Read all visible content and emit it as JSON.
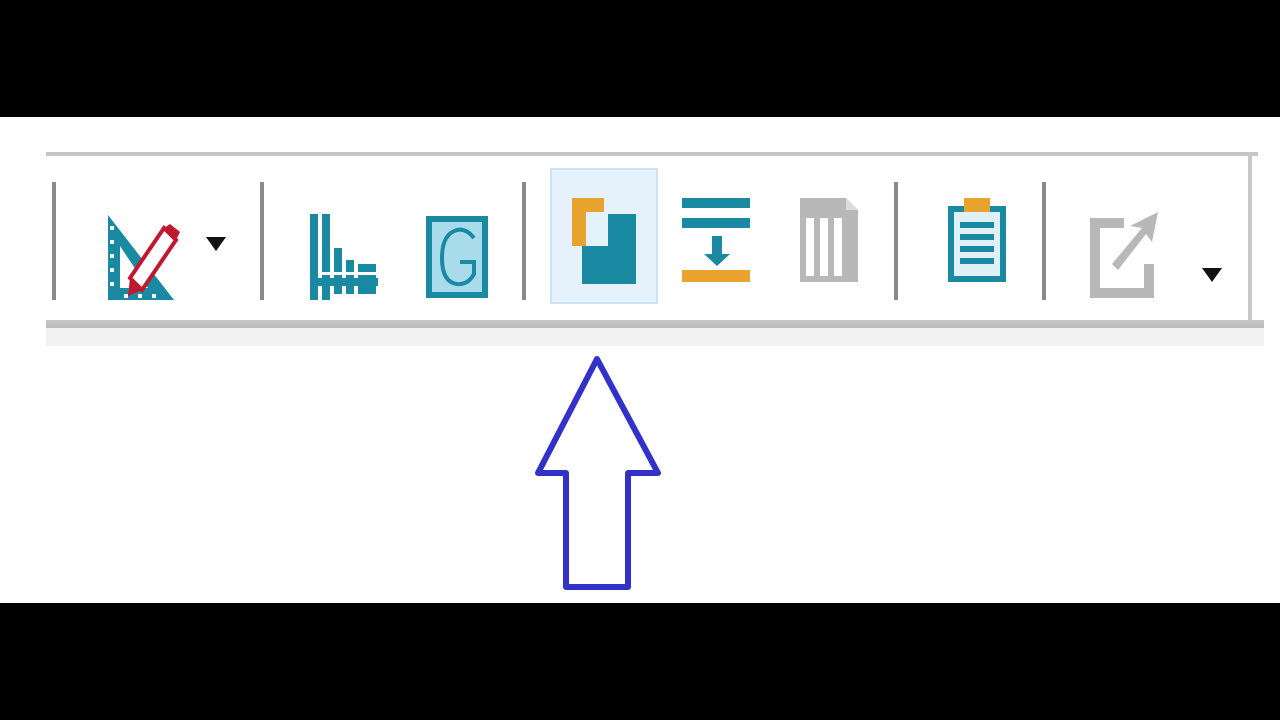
{
  "toolbar": {
    "buttons": [
      {
        "id": "draft-tools",
        "icon": "ruler-triangle-pencil-icon",
        "has_dropdown": true
      },
      {
        "id": "graph-chart",
        "icon": "bar-chart-icon"
      },
      {
        "id": "graph-g",
        "icon": "graph-g-icon",
        "label": "G"
      },
      {
        "id": "bring-to-front",
        "icon": "overlap-shapes-icon",
        "active": true
      },
      {
        "id": "insert-between-lines",
        "icon": "insert-line-arrow-icon"
      },
      {
        "id": "columns",
        "icon": "columns-page-icon",
        "disabled": true
      },
      {
        "id": "clipboard",
        "icon": "clipboard-list-icon"
      },
      {
        "id": "export",
        "icon": "external-link-icon",
        "disabled": true,
        "has_dropdown": true
      }
    ]
  },
  "colors": {
    "teal": "#1a8aa3",
    "orange": "#e8a32e",
    "red": "#c0182f",
    "disabled": "#b8b8b8",
    "annotation_arrow": "#3232c8",
    "active_bg": "#e5f1fb"
  }
}
